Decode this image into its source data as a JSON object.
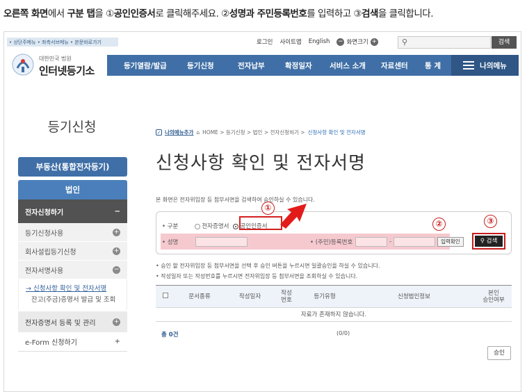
{
  "instruction": {
    "p1": "오른쪽 화면",
    "p2": "에서 ",
    "p3": "구분 탭",
    "p4": "을 ①",
    "p5": "공인인증서",
    "p6": "로 클릭해주세요. ②",
    "p7": "성명과 주민등록번호",
    "p8": "를 입력하고 ③",
    "p9": "검색",
    "p10": "을 클릭합니다."
  },
  "topbar": {
    "skip": "• 상단주메뉴 • 좌측서브메뉴 • 본문바로가기",
    "login": "로그인",
    "sitemap": "사이트맵",
    "english": "English",
    "zoom_label": "화면크기",
    "zoom_minus": "−",
    "zoom_plus": "+",
    "search_btn": "검색"
  },
  "logo": {
    "small": "대한민국 법원",
    "big": "인터넷등기소"
  },
  "gnb": {
    "items": [
      "등기열람/발급",
      "등기신청",
      "전자납부",
      "확정일자",
      "서비스 소개",
      "자료센터",
      "통 계"
    ],
    "mymenu": "나의메뉴"
  },
  "lnb": {
    "title": "등기신청",
    "top": "부동산(통합전자등기)",
    "selected": "법인",
    "dark": "전자신청하기",
    "dark_mark": "−",
    "rows": [
      "등기신청사용",
      "회사설립등기신청",
      "전자서명사용"
    ],
    "row_marks": [
      "+",
      "+",
      "−"
    ],
    "sub": [
      "신청사항 확인 및 전자서명",
      "잔고(주금)증명서 발급 및 조회"
    ],
    "gray2": "전자증명서 등록 및 관리",
    "gray2_mark": "+",
    "white": "e-Form 신청하기",
    "white_mark": "+"
  },
  "breadcrumb": {
    "add": "나의메뉴추가",
    "path": "HOME > 등기신청 > 법인 > 전자신청하기 >",
    "current": "신청사항 확인 및 전자서명"
  },
  "page_title": "신청사항 확인 및 전자서명",
  "desc": "본 화면은 전자위임장 등 첨부서면을 검색하여 승인하실 수 있습니다.",
  "form": {
    "type_label": "• 구분",
    "opt1": "전자증명서",
    "opt2": "공인인증서",
    "name_label": "• 성명",
    "rrn_label": "• (주민)등록번호",
    "dash": "-",
    "verify": "입력확인",
    "search": "검색"
  },
  "markers": [
    "①",
    "②",
    "③"
  ],
  "notes": [
    "• 승인 할 전자위임장 등 첨부서면을 선택 후 승인 버튼을 누르시면 일괄승인을 하실 수 있습니다.",
    "• 작성일자 또는 작성번호를 누르시면 전자위임장 등 첨부서면을 조회하실 수 있습니다."
  ],
  "table": {
    "headers": [
      "문서종류",
      "작성일자",
      "작성\n번호",
      "등기유형",
      "신청법인정보",
      "본인\n승인여부"
    ],
    "empty": "자료가 존재하지 않습니다."
  },
  "footer": {
    "total": "총 0건",
    "pager": "(0/0)",
    "approve": "승인"
  },
  "colors": {
    "nav_blue": "#3f6fa6",
    "highlight_red": "#d42020",
    "pink_band": "#f6c9cf"
  }
}
